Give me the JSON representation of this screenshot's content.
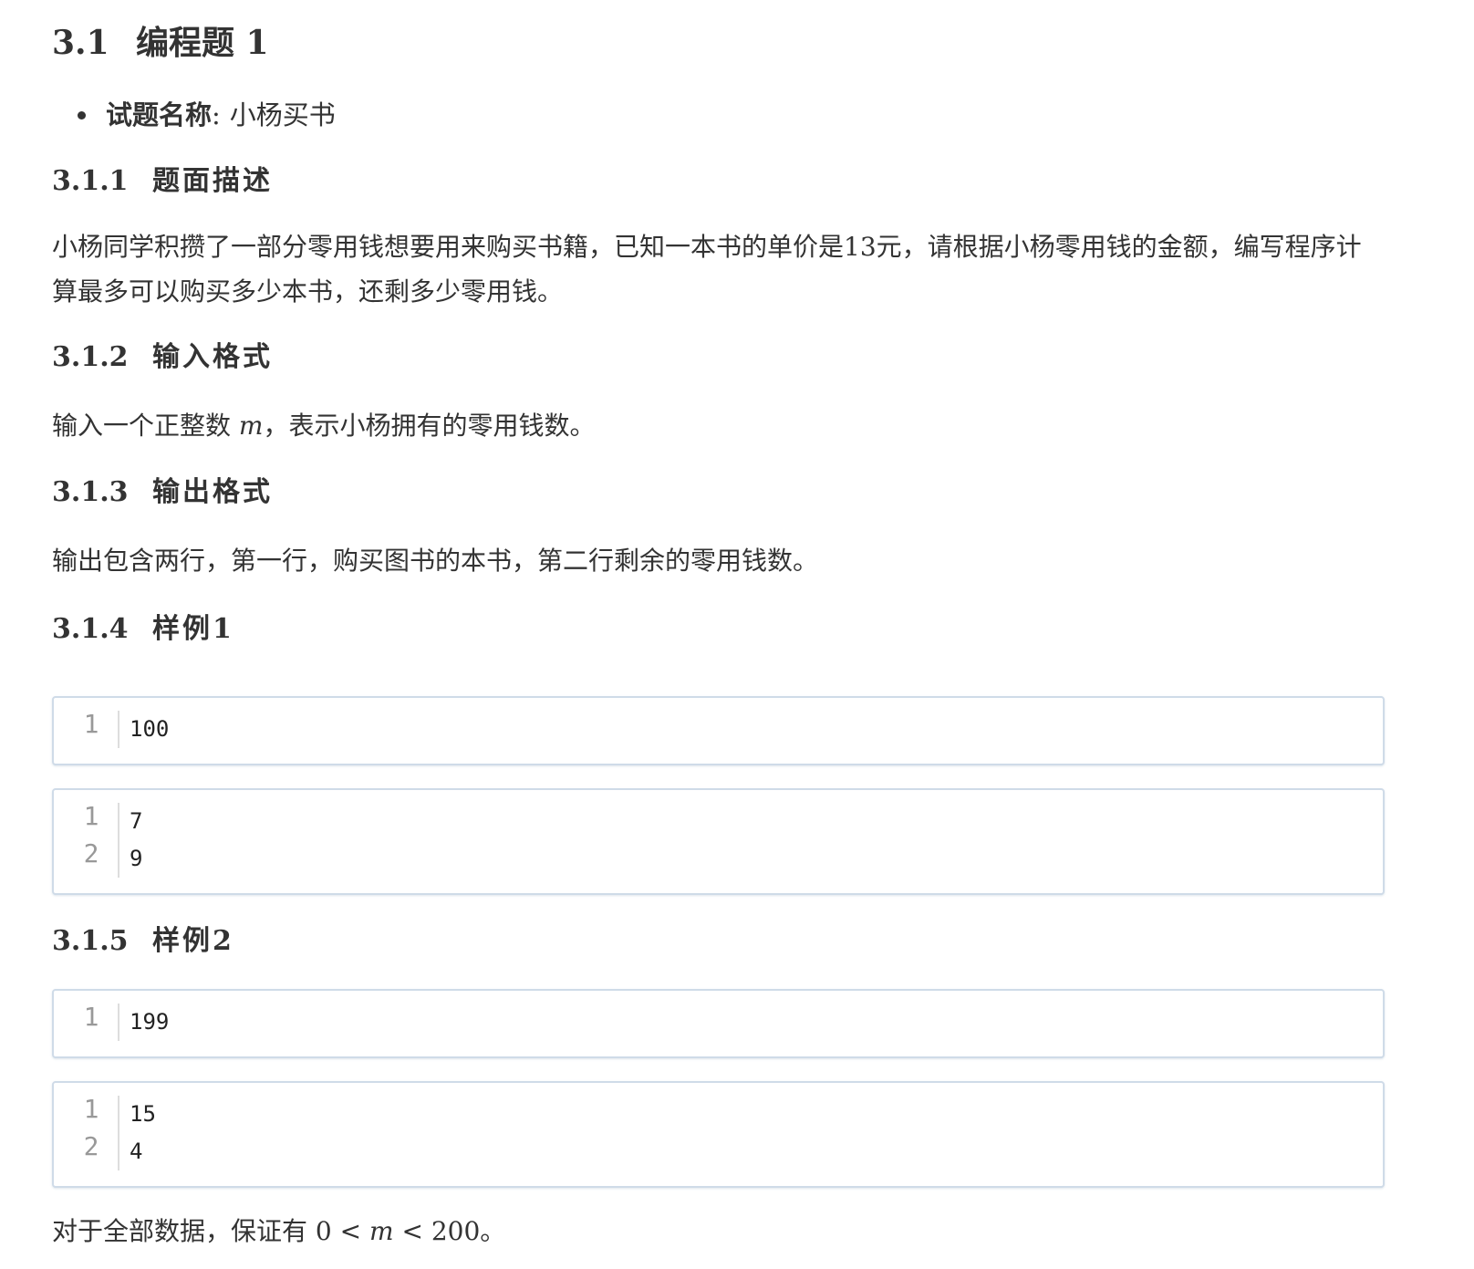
{
  "section": {
    "number": "3.1",
    "title": "编程题 1"
  },
  "problem": {
    "name_label": "试题名称",
    "name_sep": ":",
    "name_value": "小杨买书"
  },
  "subsections": {
    "description": {
      "number": "3.1.1",
      "title": "题面描述"
    },
    "input": {
      "number": "3.1.2",
      "title": "输入格式"
    },
    "output": {
      "number": "3.1.3",
      "title": "输出格式"
    },
    "sample1": {
      "number": "3.1.4",
      "title": "样例1"
    },
    "sample2": {
      "number": "3.1.5",
      "title": "样例2"
    }
  },
  "description_text": "小杨同学积攒了一部分零用钱想要用来购买书籍，已知一本书的单价是13元，请根据小杨零用钱的金额，编写程序计算最多可以购买多少本书，还剩多少零用钱。",
  "input_text": {
    "before": "输入一个正整数 ",
    "var": "m",
    "after": "，表示小杨拥有的零用钱数。"
  },
  "output_text": "输出包含两行，第一行，购买图书的本书，第二行剩余的零用钱数。",
  "samples": {
    "s1_in": {
      "line_numbers": [
        "1"
      ],
      "lines": [
        "100"
      ]
    },
    "s1_out": {
      "line_numbers": [
        "1",
        "2"
      ],
      "lines": [
        "7",
        "9"
      ]
    },
    "s2_in": {
      "line_numbers": [
        "1"
      ],
      "lines": [
        "199"
      ]
    },
    "s2_out": {
      "line_numbers": [
        "1",
        "2"
      ],
      "lines": [
        "15",
        "4"
      ]
    }
  },
  "constraint": {
    "before": "对于全部数据，保证有 ",
    "low": "0",
    "lt1": " < ",
    "var": "m",
    "lt2": " < ",
    "high": "200",
    "after": "。"
  }
}
